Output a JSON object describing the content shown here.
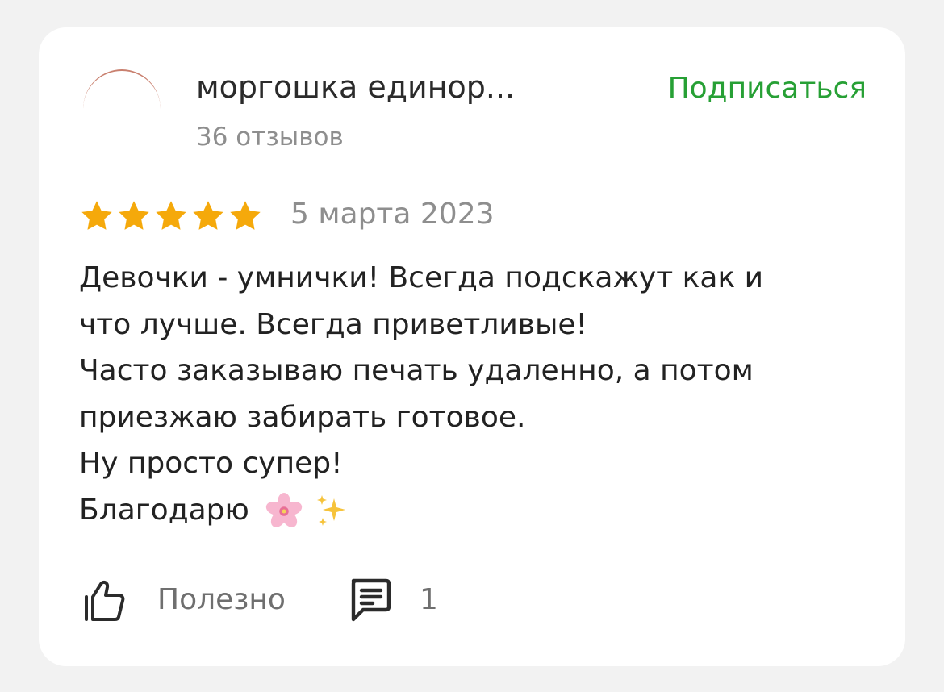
{
  "author": {
    "name": "моргошка единор...",
    "review_count": "36 отзывов"
  },
  "subscribe_label": "Подписаться",
  "review": {
    "rating": 5,
    "max_rating": 5,
    "date": "5 марта 2023",
    "lines": [
      "Девочки - умнички! Всегда подскажут как и",
      "что лучше. Всегда приветливые!",
      "Часто заказываю печать удаленно, а потом",
      "приезжаю забирать готовое.",
      "Ну просто супер!",
      "Благодарю"
    ],
    "trailing_emoji": [
      "cherry-blossom-icon",
      "sparkles-icon"
    ]
  },
  "actions": {
    "useful_label": "Полезно",
    "comment_count": "1"
  },
  "colors": {
    "accent_green": "#27a035",
    "star": "#f5a90b",
    "text": "#222222",
    "muted": "#8e8e8e"
  }
}
